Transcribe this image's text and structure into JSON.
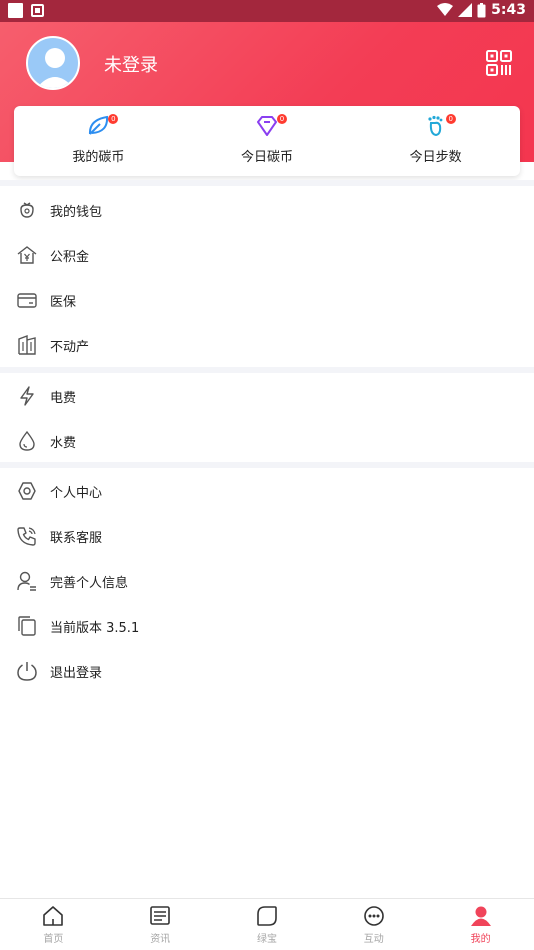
{
  "status_bar": {
    "time": "5:43"
  },
  "header": {
    "login_text": "未登录"
  },
  "stats": [
    {
      "label": "我的碳币",
      "badge": "0",
      "icon": "leaf-icon",
      "color": "#2d8ef0"
    },
    {
      "label": "今日碳币",
      "badge": "0",
      "icon": "diamond-icon",
      "color": "#8a3ff0"
    },
    {
      "label": "今日步数",
      "badge": "0",
      "icon": "footprint-icon",
      "color": "#22a8d8"
    }
  ],
  "menu_group_1": [
    {
      "label": "我的钱包",
      "icon": "wallet-icon"
    },
    {
      "label": "公积金",
      "icon": "housing-fund-icon"
    },
    {
      "label": "医保",
      "icon": "card-icon"
    },
    {
      "label": "不动产",
      "icon": "building-icon"
    }
  ],
  "menu_group_2": [
    {
      "label": "电费",
      "icon": "lightning-icon"
    },
    {
      "label": "水费",
      "icon": "water-drop-icon"
    }
  ],
  "menu_group_3": [
    {
      "label": "个人中心",
      "icon": "settings-icon"
    },
    {
      "label": "联系客服",
      "icon": "phone-icon"
    },
    {
      "label": "完善个人信息",
      "icon": "user-edit-icon"
    },
    {
      "label": "当前版本 3.5.1",
      "icon": "copy-icon"
    },
    {
      "label": "退出登录",
      "icon": "power-icon"
    }
  ],
  "bottom_nav": [
    {
      "label": "首页",
      "icon": "home-icon"
    },
    {
      "label": "资讯",
      "icon": "news-icon"
    },
    {
      "label": "绿宝",
      "icon": "leaf-note-icon"
    },
    {
      "label": "互动",
      "icon": "chat-icon"
    },
    {
      "label": "我的",
      "icon": "user-icon",
      "active": true
    }
  ],
  "colors": {
    "header": "#f33d55",
    "status_bar": "#a3273d",
    "active": "#f0445a"
  }
}
